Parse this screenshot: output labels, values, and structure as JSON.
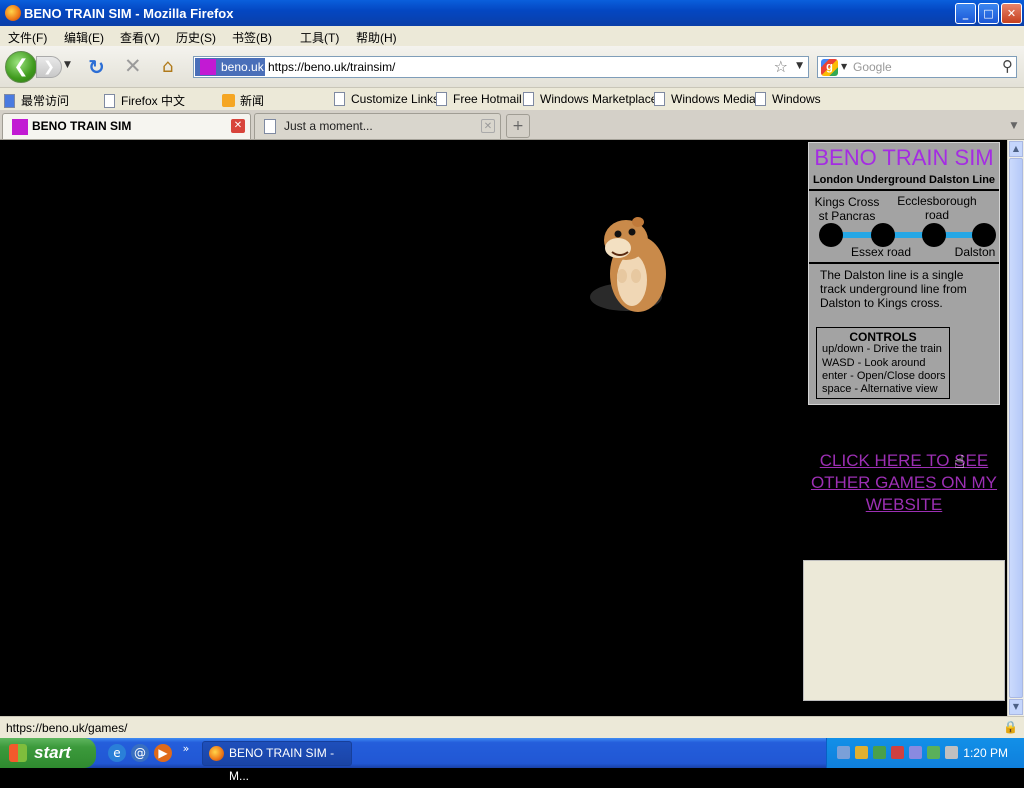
{
  "window": {
    "title": "BENO TRAIN SIM - Mozilla Firefox",
    "controls": {
      "minimize": "_",
      "maximize": "□",
      "close": "✕"
    }
  },
  "menu": [
    "文件(F)",
    "编辑(E)",
    "查看(V)",
    "历史(S)",
    "书签(B)",
    "工具(T)",
    "帮助(H)"
  ],
  "nav": {
    "site_label": "beno.uk",
    "url": "https://beno.uk/trainsim/",
    "search_placeholder": "Google",
    "icons": {
      "back": "arrow-left-icon",
      "forward": "arrow-right-icon",
      "reload": "reload-icon",
      "stop": "stop-icon",
      "home": "home-icon",
      "star": "star-icon",
      "search": "magnifier-icon"
    }
  },
  "bookmarks": [
    "最常访问",
    "Firefox 中文",
    "新闻",
    "Customize Links",
    "Free Hotmail",
    "Windows Marketplace",
    "Windows Media",
    "Windows"
  ],
  "tabs": [
    {
      "label": "BENO TRAIN SIM",
      "active": true
    },
    {
      "label": "Just a moment...",
      "active": false
    }
  ],
  "page": {
    "title": "BENO TRAIN SIM",
    "subtitle": "London Underground Dalston Line",
    "stations": {
      "top1": "Kings Cross st Pancras",
      "top2": "Ecclesborough road",
      "bottom1": "Essex road",
      "bottom2": "Dalston"
    },
    "line_color": "#25a7e6",
    "title_color": "#a42ce2",
    "description": "The Dalston line is a single track underground line from Dalston to Kings cross.",
    "controls": {
      "heading": "CONTROLS",
      "lines": [
        "up/down - Drive the train",
        "WASD - Look around",
        "enter - Open/Close doors",
        "space - Alternative view"
      ]
    },
    "games_link": "CLICK HERE TO SEE OTHER GAMES ON MY WEBSITE"
  },
  "status": {
    "text": "https://beno.uk/games/"
  },
  "taskbar": {
    "start": "start",
    "task": "BENO TRAIN SIM - M...",
    "clock": "1:20 PM"
  }
}
